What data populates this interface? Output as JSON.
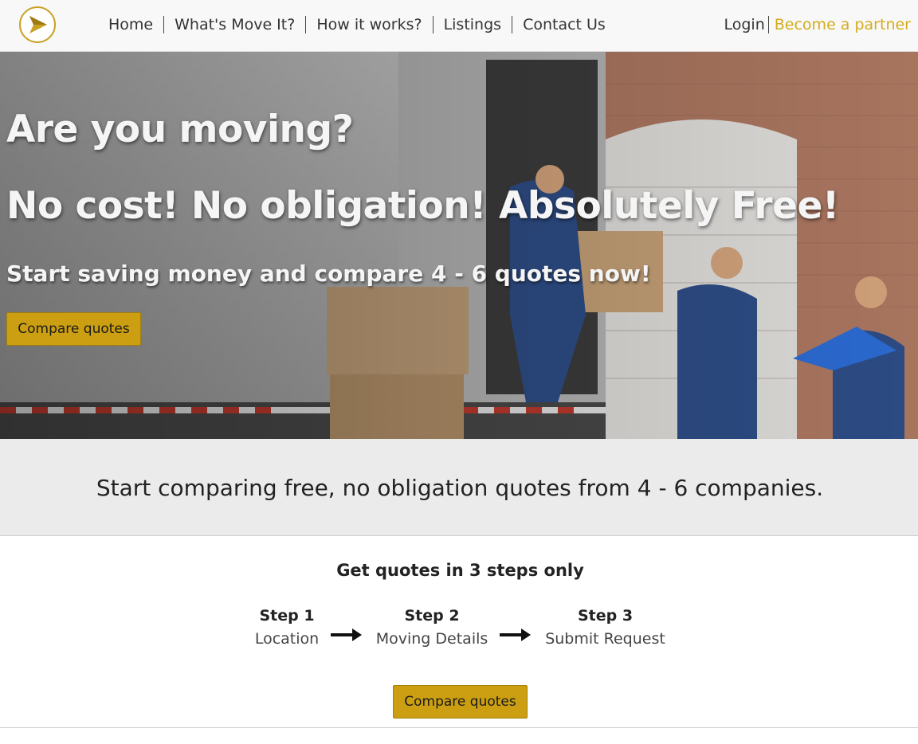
{
  "colors": {
    "accent": "#d4ac1e",
    "button_bg": "#cc9f12",
    "band_bg": "#ebebeb",
    "header_bg": "#f8f8f8"
  },
  "header": {
    "logo_icon": "play-arrow-circle-icon",
    "nav": [
      "Home",
      "What's Move It?",
      "How it works?",
      "Listings",
      "Contact Us"
    ],
    "login_label": "Login",
    "partner_label": "Become a partner"
  },
  "hero": {
    "title": "Are you moving?",
    "title2": "No cost! No obligation! Absolutely Free!",
    "subtitle": "Start saving money and compare 4 - 6 quotes now!",
    "button_label": "Compare quotes"
  },
  "band": {
    "text": "Start comparing free, no obligation quotes from 4 - 6 companies."
  },
  "steps": {
    "title": "Get quotes in 3 steps only",
    "items": [
      {
        "head": "Step 1",
        "body": "Location"
      },
      {
        "head": "Step 2",
        "body": "Moving Details"
      },
      {
        "head": "Step 3",
        "body": "Submit Request"
      }
    ],
    "arrow_icon": "long-arrow-right-icon",
    "button_label": "Compare quotes"
  }
}
